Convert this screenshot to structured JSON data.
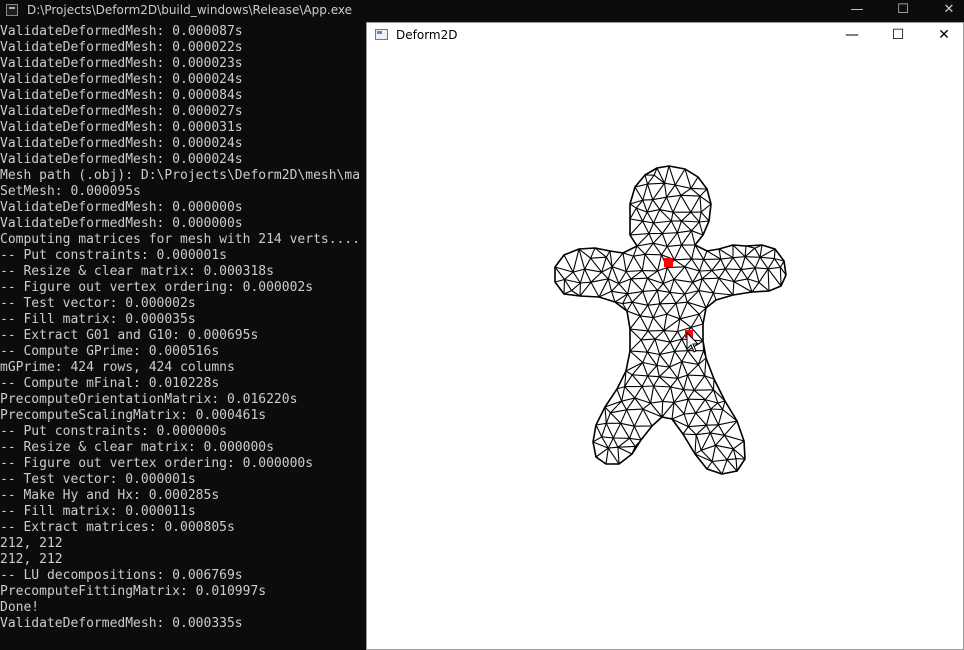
{
  "console": {
    "title": "D:\\Projects\\Deform2D\\build_windows\\Release\\App.exe",
    "lines": [
      "ValidateDeformedMesh: 0.000087s",
      "ValidateDeformedMesh: 0.000022s",
      "ValidateDeformedMesh: 0.000023s",
      "ValidateDeformedMesh: 0.000024s",
      "ValidateDeformedMesh: 0.000084s",
      "ValidateDeformedMesh: 0.000027s",
      "ValidateDeformedMesh: 0.000031s",
      "ValidateDeformedMesh: 0.000024s",
      "ValidateDeformedMesh: 0.000024s",
      "Mesh path (.obj): D:\\Projects\\Deform2D\\mesh\\ma",
      "SetMesh: 0.000095s",
      "ValidateDeformedMesh: 0.000000s",
      "ValidateDeformedMesh: 0.000000s",
      "Computing matrices for mesh with 214 verts....",
      "-- Put constraints: 0.000001s",
      "-- Resize & clear matrix: 0.000318s",
      "-- Figure out vertex ordering: 0.000002s",
      "-- Test vector: 0.000002s",
      "-- Fill matrix: 0.000035s",
      "-- Extract G01 and G10: 0.000695s",
      "-- Compute GPrime: 0.000516s",
      "mGPrime: 424 rows, 424 columns",
      "-- Compute mFinal: 0.010228s",
      "PrecomputeOrientationMatrix: 0.016220s",
      "PrecomputeScalingMatrix: 0.000461s",
      "-- Put constraints: 0.000000s",
      "-- Resize & clear matrix: 0.000000s",
      "-- Figure out vertex ordering: 0.000000s",
      "-- Test vector: 0.000001s",
      "-- Make Hy and Hx: 0.000285s",
      "-- Fill matrix: 0.000011s",
      "-- Extract matrices: 0.000805s",
      "212, 212",
      "212, 212",
      "-- LU decompositions: 0.006769s",
      "PrecomputeFittingMatrix: 0.010997s",
      "Done!",
      "ValidateDeformedMesh: 0.000335s"
    ]
  },
  "window_controls": {
    "minimize": "—",
    "maximize": "☐",
    "close": "✕"
  },
  "gl_window": {
    "title": "Deform2D"
  },
  "colors": {
    "console_bg": "#0c0c0c",
    "console_text": "#cccccc",
    "mesh_line": "#000000",
    "handle": "#ff0000"
  }
}
